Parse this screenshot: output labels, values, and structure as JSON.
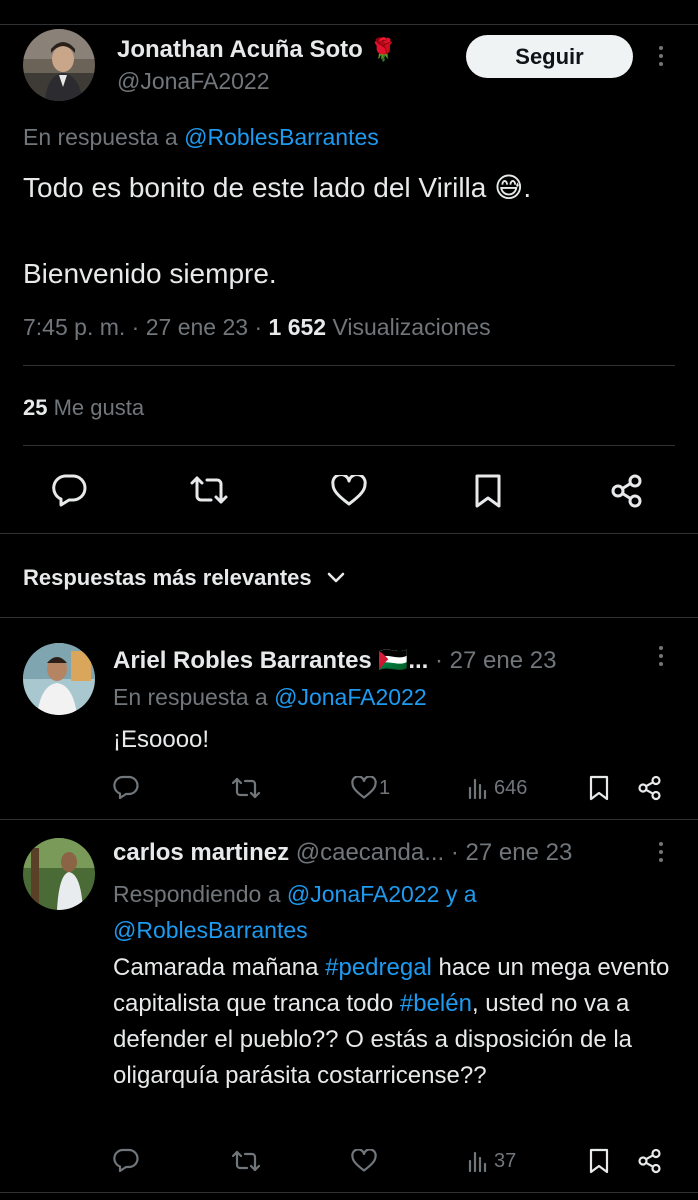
{
  "main_tweet": {
    "author_name": "Jonathan Acuña Soto",
    "author_emoji": "🌹",
    "handle": "@JonaFA2022",
    "follow_label": "Seguir",
    "reply_prefix": "En respuesta a",
    "reply_to": "@RoblesBarrantes",
    "text_line1": "Todo es bonito de este lado del Virilla 😅.",
    "text_line2": "Bienvenido siempre.",
    "time": "7:45 p. m.",
    "date": "27 ene 23",
    "views_count": "1 652",
    "views_label": "Visualizaciones",
    "likes_count": "25",
    "likes_label": "Me gusta"
  },
  "replies_header": {
    "label": "Respuestas más relevantes"
  },
  "replies": [
    {
      "author_name": "Ariel Robles Barrantes 🇵🇸...",
      "date": "· 27 ene 23",
      "reply_prefix": "En respuesta a",
      "reply_to": "@JonaFA2022",
      "text": "¡Esoooo!",
      "likes": "1",
      "views": "646"
    },
    {
      "author_name": "carlos martinez",
      "handle": "@caecanda...",
      "date": "· 27 ene 23",
      "reply_prefix": "Respondiendo a",
      "reply_to_1": "@JonaFA2022 y a",
      "reply_to_2": "@RoblesBarrantes",
      "text_1": "Camarada mañana ",
      "hashtag_1": "#pedregal",
      "text_2": " hace un mega evento capitalista que tranca todo ",
      "hashtag_2": "#belén",
      "text_3": ", usted no va a defender el pueblo?? O estás a disposición de la oligarquía parásita costarricense??",
      "likes": "",
      "views": "37"
    }
  ],
  "colors": {
    "background": "#000000",
    "text": "#e7e9ea",
    "muted": "#71767b",
    "link": "#1d9bf0",
    "divider": "#2f3336"
  }
}
